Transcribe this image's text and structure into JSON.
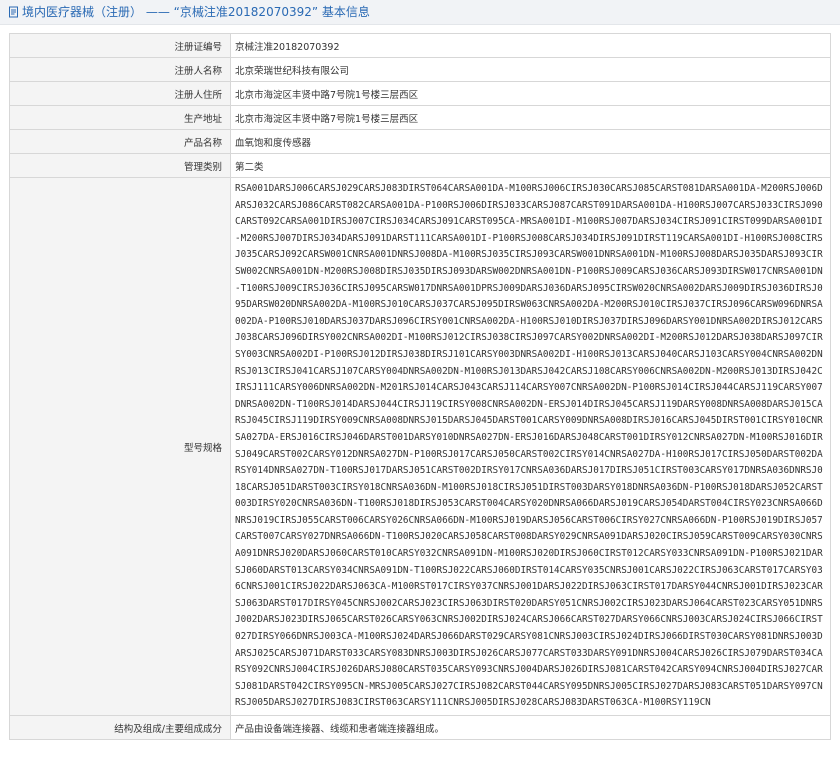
{
  "breadcrumb": {
    "icon": "document-icon",
    "section": "境内医疗器械（注册）",
    "separator": "——",
    "registration": "“京械注准20182070392”",
    "page": "基本信息"
  },
  "fields": [
    {
      "label": "注册证编号",
      "value": "京械注准20182070392"
    },
    {
      "label": "注册人名称",
      "value": "北京荣瑞世纪科技有限公司"
    },
    {
      "label": "注册人住所",
      "value": "北京市海淀区丰贤中路7号院1号楼三层西区"
    },
    {
      "label": "生产地址",
      "value": "北京市海淀区丰贤中路7号院1号楼三层西区"
    },
    {
      "label": "产品名称",
      "value": "血氧饱和度传感器"
    },
    {
      "label": "管理类别",
      "value": "第二类"
    }
  ],
  "models": {
    "label": "型号规格",
    "value": "RSA001DARSJ006CARSJ029CARSJ083DIRST064CARSA001DA-M100RSJ006CIRSJ030CARSJ085CARST081DARSA001DA-M200RSJ006DARSJ032CARSJ086CARST082CARSA001DA-P100RSJ006DIRSJ033CARSJ087CARST091DARSA001DA-H100RSJ007CARSJ033CIRSJ090CARST092CARSA001DIRSJ007CIRSJ034CARSJ091CARST095CA-MRSA001DI-M100RSJ007DARSJ034CIRSJ091CIRST099DARSA001DI-M200RSJ007DIRSJ034DARSJ091DARST111CARSA001DI-P100RSJ008CARSJ034DIRSJ091DIRST119CARSA001DI-H100RSJ008CIRSJ035CARSJ092CARSW001CNRSA001DNRSJ008DA-M100RSJ035CIRSJ093CARSW001DNRSA001DN-M100RSJ008DARSJ035DARSJ093CIRSW002CNRSA001DN-M200RSJ008DIRSJ035DIRSJ093DARSW002DNRSA001DN-P100RSJ009CARSJ036CARSJ093DIRSW017CNRSA001DN-T100RSJ009CIRSJ036CIRSJ095CARSW017DNRSA001DPRSJ009DARSJ036DARSJ095CIRSW020CNRSA002DARSJ009DIRSJ036DIRSJ095DARSW020DNRSA002DA-M100RSJ010CARSJ037CARSJ095DIRSW063CNRSA002DA-M200RSJ010CIRSJ037CIRSJ096CARSW096DNRSA002DA-P100RSJ010DARSJ037DARSJ096CIRSY001CNRSA002DA-H100RSJ010DIRSJ037DIRSJ096DARSY001DNRSA002DIRSJ012CARSJ038CARSJ096DIRSY002CNRSA002DI-M100RSJ012CIRSJ038CIRSJ097CARSY002DNRSA002DI-M200RSJ012DARSJ038DARSJ097CIRSY003CNRSA002DI-P100RSJ012DIRSJ038DIRSJ101CARSY003DNRSA002DI-H100RSJ013CARSJ040CARSJ103CARSY004CNRSA002DNRSJ013CIRSJ041CARSJ107CARSY004DNRSA002DN-M100RSJ013DARSJ042CARSJ108CARSY006CNRSA002DN-M200RSJ013DIRSJ042CIRSJ111CARSY006DNRSA002DN-M201RSJ014CARSJ043CARSJ114CARSY007CNRSA002DN-P100RSJ014CIRSJ044CARSJ119CARSY007DNRSA002DN-T100RSJ014DARSJ044CIRSJ119CIRSY008CNRSA002DN-ERSJ014DIRSJ045CARSJ119DARSY008DNRSA008DARSJ015CARSJ045CIRSJ119DIRSY009CNRSA008DNRSJ015DARSJ045DARST001CARSY009DNRSA008DIRSJ016CARSJ045DIRST001CIRSY010CNRSA027DA-ERSJ016CIRSJ046DARST001DARSY010DNRSA027DN-ERSJ016DARSJ048CARST001DIRSY012CNRSA027DN-M100RSJ016DIRSJ049CARST002CARSY012DNRSA027DN-P100RSJ017CARSJ050CARST002CIRSY014CNRSA027DA-H100RSJ017CIRSJ050DARST002DARSY014DNRSA027DN-T100RSJ017DARSJ051CARST002DIRSY017CNRSA036DARSJ017DIRSJ051CIRST003CARSY017DNRSA036DNRSJ018CARSJ051DARST003CIRSY018CNRSA036DN-M100RSJ018CIRSJ051DIRST003DARSY018DNRSA036DN-P100RSJ018DARSJ052CARST003DIRSY020CNRSA036DN-T100RSJ018DIRSJ053CARST004CARSY020DNRSA066DARSJ019CARSJ054DARST004CIRSY023CNRSA066DNRSJ019CIRSJ055CARST006CARSY026CNRSA066DN-M100RSJ019DARSJ056CARST006CIRSY027CNRSA066DN-P100RSJ019DIRSJ057CARST007CARSY027DNRSA066DN-T100RSJ020CARSJ058CARST008DARSY029CNRSA091DARSJ020CIRSJ059CARST009CARSY030CNRSA091DNRSJ020DARSJ060CARST010CARSY032CNRSA091DN-M100RSJ020DIRSJ060CIRST012CARSY033CNRSA091DN-P100RSJ021DARSJ060DARST013CARSY034CNRSA091DN-T100RSJ022CARSJ060DIRST014CARSY035CNRSJ001CARSJ022CIRSJ063CARST017CARSY036CNRSJ001CIRSJ022DARSJ063CA-M100RST017CIRSY037CNRSJ001DARSJ022DIRSJ063CIRST017DARSY044CNRSJ001DIRSJ023CARSJ063DARST017DIRSY045CNRSJ002CARSJ023CIRSJ063DIRST020DARSY051CNRSJ002CIRSJ023DARSJ064CARST023CARSY051DNRSJ002DARSJ023DIRSJ065CARST026CARSY063CNRSJ002DIRSJ024CARSJ066CARST027DARSY066CNRSJ003CARSJ024CIRSJ066CIRST027DIRSY066DNRSJ003CA-M100RSJ024DARSJ066DARST029CARSY081CNRSJ003CIRSJ024DIRSJ066DIRST030CARSY081DNRSJ003DARSJ025CARSJ071DARST033CARSY083DNRSJ003DIRSJ026CARSJ077CARST033DARSY091DNRSJ004CARSJ026CIRSJ079DARST034CARSY092CNRSJ004CIRSJ026DARSJ080CARST035CARSY093CNRSJ004DARSJ026DIRSJ081CARST042CARSY094CNRSJ004DIRSJ027CARSJ081DARST042CIRSY095CN-MRSJ005CARSJ027CIRSJ082CARST044CARSY095DNRSJ005CIRSJ027DARSJ083CARST051DARSY097CNRSJ005DARSJ027DIRSJ083CIRST063CARSY111CNRSJ005DIRSJ028CARSJ083DARST063CA-M100RSY119CN"
  },
  "structure": {
    "label": "结构及组成/主要组成成分",
    "value": "产品由设备端连接器、线缆和患者端连接器组成。"
  }
}
